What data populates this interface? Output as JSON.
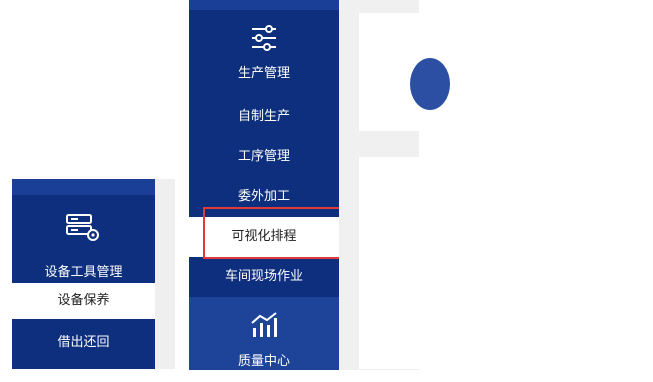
{
  "small_menu": {
    "header_label": "设备工具管理",
    "header_icon": "server-gear-icon",
    "items": [
      {
        "label": "设备保养",
        "active": true
      },
      {
        "label": "借出还回",
        "active": false
      }
    ]
  },
  "main_sidebar": {
    "header_label": "生产管理",
    "header_icon": "sliders-icon",
    "items": [
      {
        "label": "自制生产",
        "active": false
      },
      {
        "label": "工序管理",
        "active": false
      },
      {
        "label": "委外加工",
        "active": false
      },
      {
        "label": "可视化排程",
        "active": true
      },
      {
        "label": "车间现场作业",
        "active": false
      }
    ],
    "quality": {
      "label": "质量中心",
      "icon": "chart-trend-icon"
    }
  },
  "colors": {
    "sidebar_bg": "#0d2f7d",
    "sidebar_strip": "#1a3f96",
    "quality_bg": "#1d4499",
    "highlight": "#e03a3a",
    "content_bg": "#f0f0f0"
  }
}
